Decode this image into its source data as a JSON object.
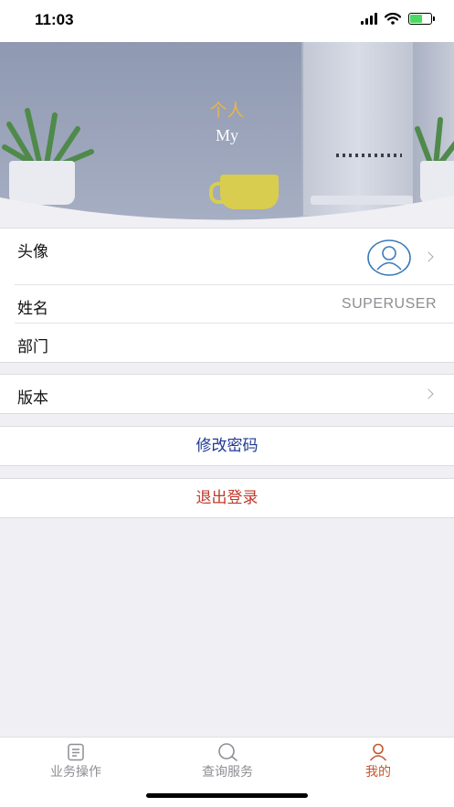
{
  "status_bar": {
    "time": "11:03"
  },
  "header": {
    "title": "个人",
    "subtitle": "My"
  },
  "profile": {
    "avatar_label": "头像",
    "name_label": "姓名",
    "name_value": "SUPERUSER",
    "department_label": "部门",
    "department_value": ""
  },
  "version": {
    "label": "版本"
  },
  "actions": {
    "change_password": "修改密码",
    "logout": "退出登录"
  },
  "tabs": [
    {
      "label": "业务操作",
      "icon": "document-icon",
      "active": false
    },
    {
      "label": "查询服务",
      "icon": "search-icon",
      "active": false
    },
    {
      "label": "我的",
      "icon": "person-icon",
      "active": true
    }
  ],
  "colors": {
    "accent_tab": "#c0582f",
    "action_blue": "#1f3a93",
    "logout_red": "#c0392b",
    "header_title": "#e8b44a",
    "avatar_blue": "#3a7ab8"
  }
}
